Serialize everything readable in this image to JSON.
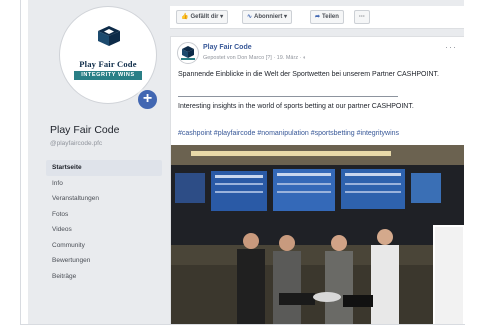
{
  "page": {
    "name": "Play Fair Code",
    "handle": "@playfaircode.pfc",
    "logo": {
      "brand": "Play Fair Code",
      "tagline": "INTEGRITY WINS"
    }
  },
  "nav": {
    "items": [
      {
        "label": "Startseite",
        "active": true
      },
      {
        "label": "Info"
      },
      {
        "label": "Veranstaltungen"
      },
      {
        "label": "Fotos"
      },
      {
        "label": "Videos"
      },
      {
        "label": "Community"
      },
      {
        "label": "Bewertungen"
      },
      {
        "label": "Beiträge"
      }
    ]
  },
  "actions": {
    "like": "Gefällt dir ▾",
    "follow": "Abonniert ▾",
    "share": "Teilen",
    "more": "···"
  },
  "post": {
    "author": "Play Fair Code",
    "meta": "Gepostet von Don Marco [?] · 19. März · ◐",
    "more": "···",
    "text_de": "Spannende Einblicke in die Welt der Sportwetten bei unserem Partner CASHPOINT.",
    "text_en": "Interesting insights in the world of sports betting at our partner CASHPOINT.",
    "hashtags": "#cashpoint #playfaircode #nomanipulation #sportsbetting #integritywins"
  },
  "colors": {
    "brand_blue": "#4267b2",
    "link_blue": "#385898",
    "logo_navy": "#0d2b48",
    "logo_teal": "#2a7f86",
    "page_bg": "#e9ebee"
  }
}
